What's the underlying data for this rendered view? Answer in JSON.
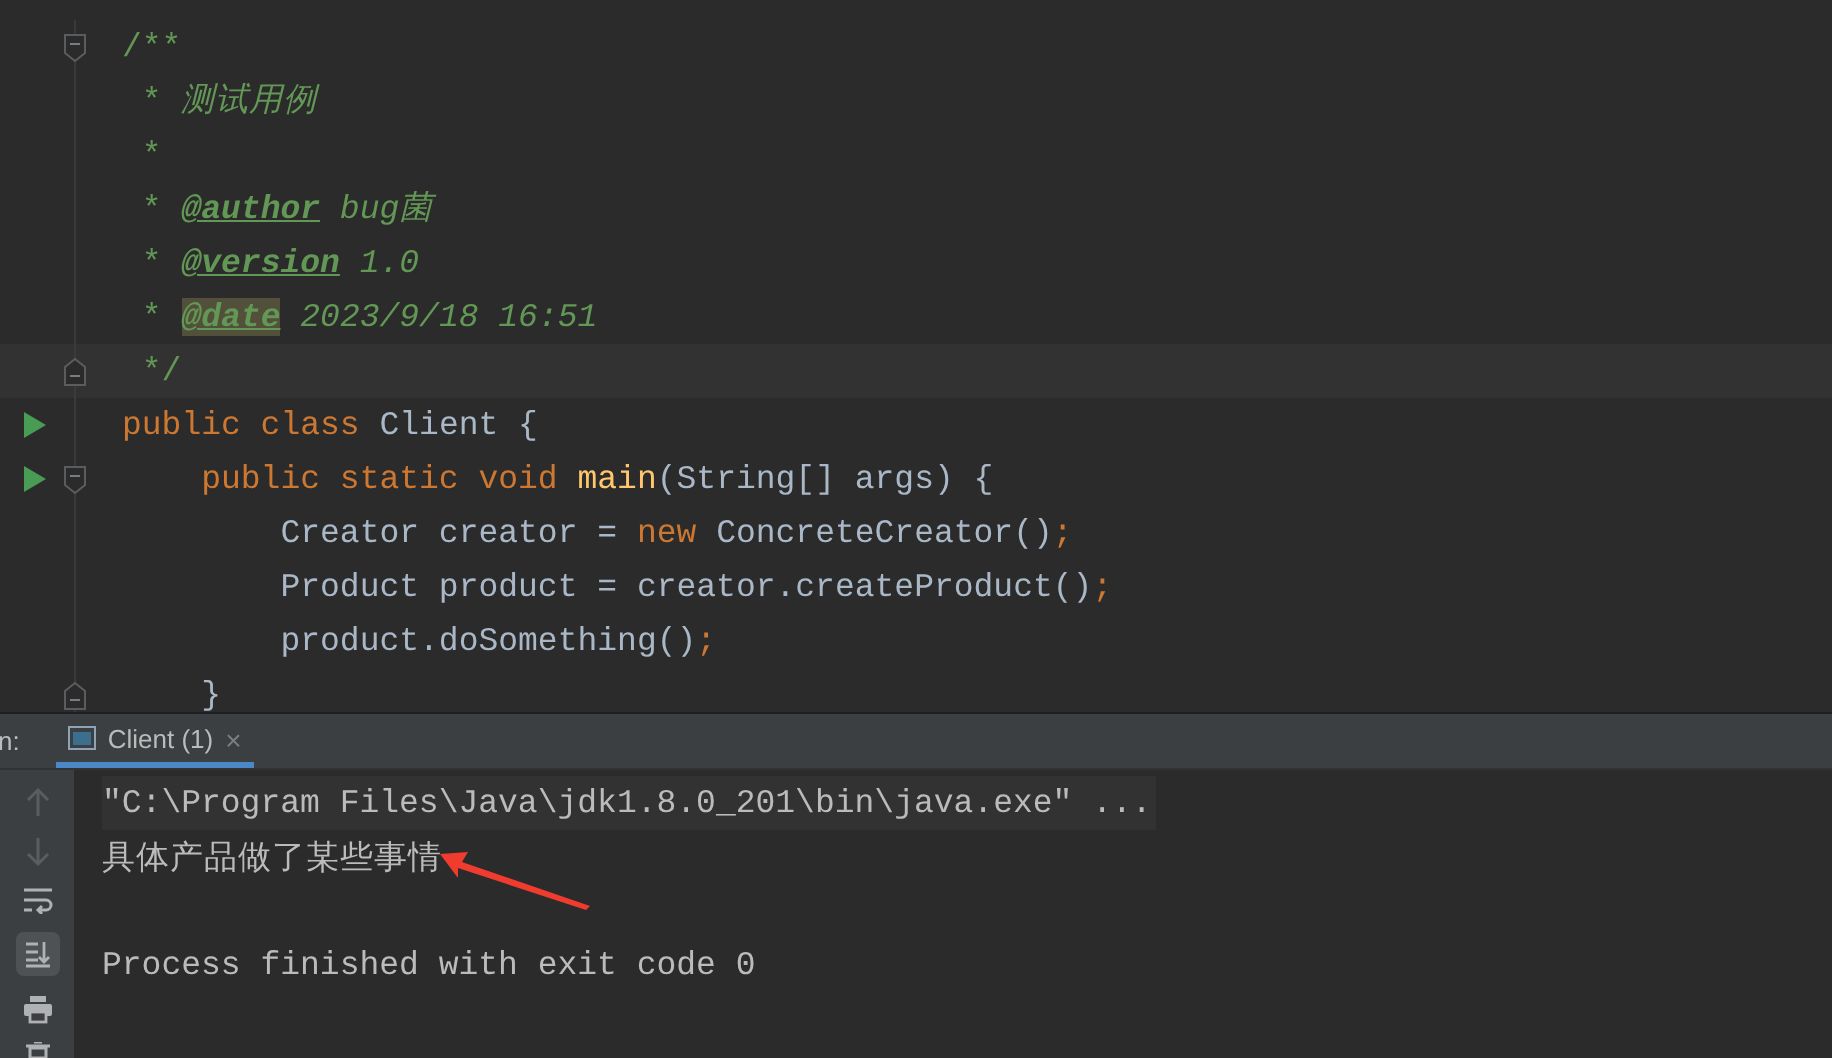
{
  "editor": {
    "lines": [
      {
        "fold_start": true,
        "tokens": [
          {
            "kind": "comment",
            "text": "/**"
          }
        ]
      },
      {
        "tokens": [
          {
            "kind": "comment",
            "text": " * "
          },
          {
            "kind": "comment-italic",
            "text": "测试用例"
          }
        ]
      },
      {
        "tokens": [
          {
            "kind": "comment",
            "text": " *"
          }
        ]
      },
      {
        "tokens": [
          {
            "kind": "comment",
            "text": " * "
          },
          {
            "kind": "doc-tag",
            "text": "@author"
          },
          {
            "kind": "comment-italic",
            "text": " bug菌"
          }
        ]
      },
      {
        "tokens": [
          {
            "kind": "comment",
            "text": " * "
          },
          {
            "kind": "doc-tag",
            "text": "@version"
          },
          {
            "kind": "comment-italic",
            "text": " 1.0"
          }
        ]
      },
      {
        "tokens": [
          {
            "kind": "comment",
            "text": " * "
          },
          {
            "kind": "doc-tag-hl",
            "text": "@date"
          },
          {
            "kind": "comment-italic",
            "text": " 2023/9/18 16:51"
          }
        ]
      },
      {
        "fold_end": true,
        "current": true,
        "tokens": [
          {
            "kind": "comment",
            "text": " */"
          }
        ]
      },
      {
        "run": true,
        "tokens": [
          {
            "kind": "keyword",
            "text": "public class "
          },
          {
            "kind": "plain",
            "text": "Client {"
          }
        ]
      },
      {
        "fold_start": true,
        "run": true,
        "tokens": [
          {
            "kind": "keyword",
            "text": "    public static void "
          },
          {
            "kind": "method",
            "text": "main"
          },
          {
            "kind": "plain",
            "text": "(String[] args) {"
          }
        ]
      },
      {
        "tokens": [
          {
            "kind": "plain",
            "text": "        Creator creator = "
          },
          {
            "kind": "keyword",
            "text": "new "
          },
          {
            "kind": "plain",
            "text": "ConcreteCreator()"
          },
          {
            "kind": "keyword",
            "text": ";"
          }
        ]
      },
      {
        "tokens": [
          {
            "kind": "plain",
            "text": "        Product product = creator.createProduct()"
          },
          {
            "kind": "keyword",
            "text": ";"
          }
        ]
      },
      {
        "tokens": [
          {
            "kind": "plain",
            "text": "        product.doSomething()"
          },
          {
            "kind": "keyword",
            "text": ";"
          }
        ]
      },
      {
        "fold_end": true,
        "tokens": [
          {
            "kind": "plain",
            "text": "    }"
          }
        ]
      }
    ]
  },
  "run_panel": {
    "label": "n:",
    "tabs": [
      {
        "label": "Client (1)",
        "selected": true,
        "close": "×"
      }
    ],
    "output": [
      {
        "kind": "command",
        "text": "\"C:\\Program Files\\Java\\jdk1.8.0_201\\bin\\java.exe\" ..."
      },
      {
        "kind": "cjk",
        "text": "具体产品做了某些事情"
      },
      {
        "kind": "blank"
      },
      {
        "kind": "plain",
        "text": "Process finished with exit code 0"
      }
    ]
  }
}
